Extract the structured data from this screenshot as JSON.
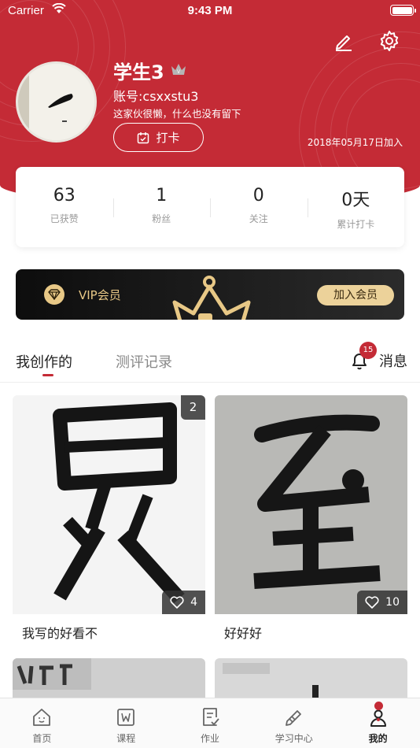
{
  "status": {
    "carrier": "Carrier",
    "time": "9:43 PM"
  },
  "profile": {
    "name": "学生3",
    "account": "账号:csxxstu3",
    "bio": "这家伙很懒，什么也没有留下",
    "checkin_label": "打卡",
    "joined": "2018年05月17日加入"
  },
  "stats": [
    {
      "value": "63",
      "label": "已获赞"
    },
    {
      "value": "1",
      "label": "粉丝"
    },
    {
      "value": "0",
      "label": "关注"
    },
    {
      "value": "0天",
      "label": "累计打卡"
    }
  ],
  "vip": {
    "label": "VIP会员",
    "join": "加入会员"
  },
  "tabs": {
    "created": "我创作的",
    "reviews": "测评记录",
    "messages": "消息",
    "message_count": "15"
  },
  "posts": [
    {
      "title": "我写的好看不",
      "image_count": "2",
      "likes": "4"
    },
    {
      "title": "好好好",
      "likes": "10"
    }
  ],
  "nav": [
    {
      "label": "首页",
      "icon": "home-icon"
    },
    {
      "label": "课程",
      "icon": "course-icon"
    },
    {
      "label": "作业",
      "icon": "homework-icon"
    },
    {
      "label": "学习中心",
      "icon": "study-center-icon"
    },
    {
      "label": "我的",
      "icon": "profile-icon"
    }
  ],
  "colors": {
    "brand": "#c42b36",
    "vip_gold": "#e8c886"
  }
}
